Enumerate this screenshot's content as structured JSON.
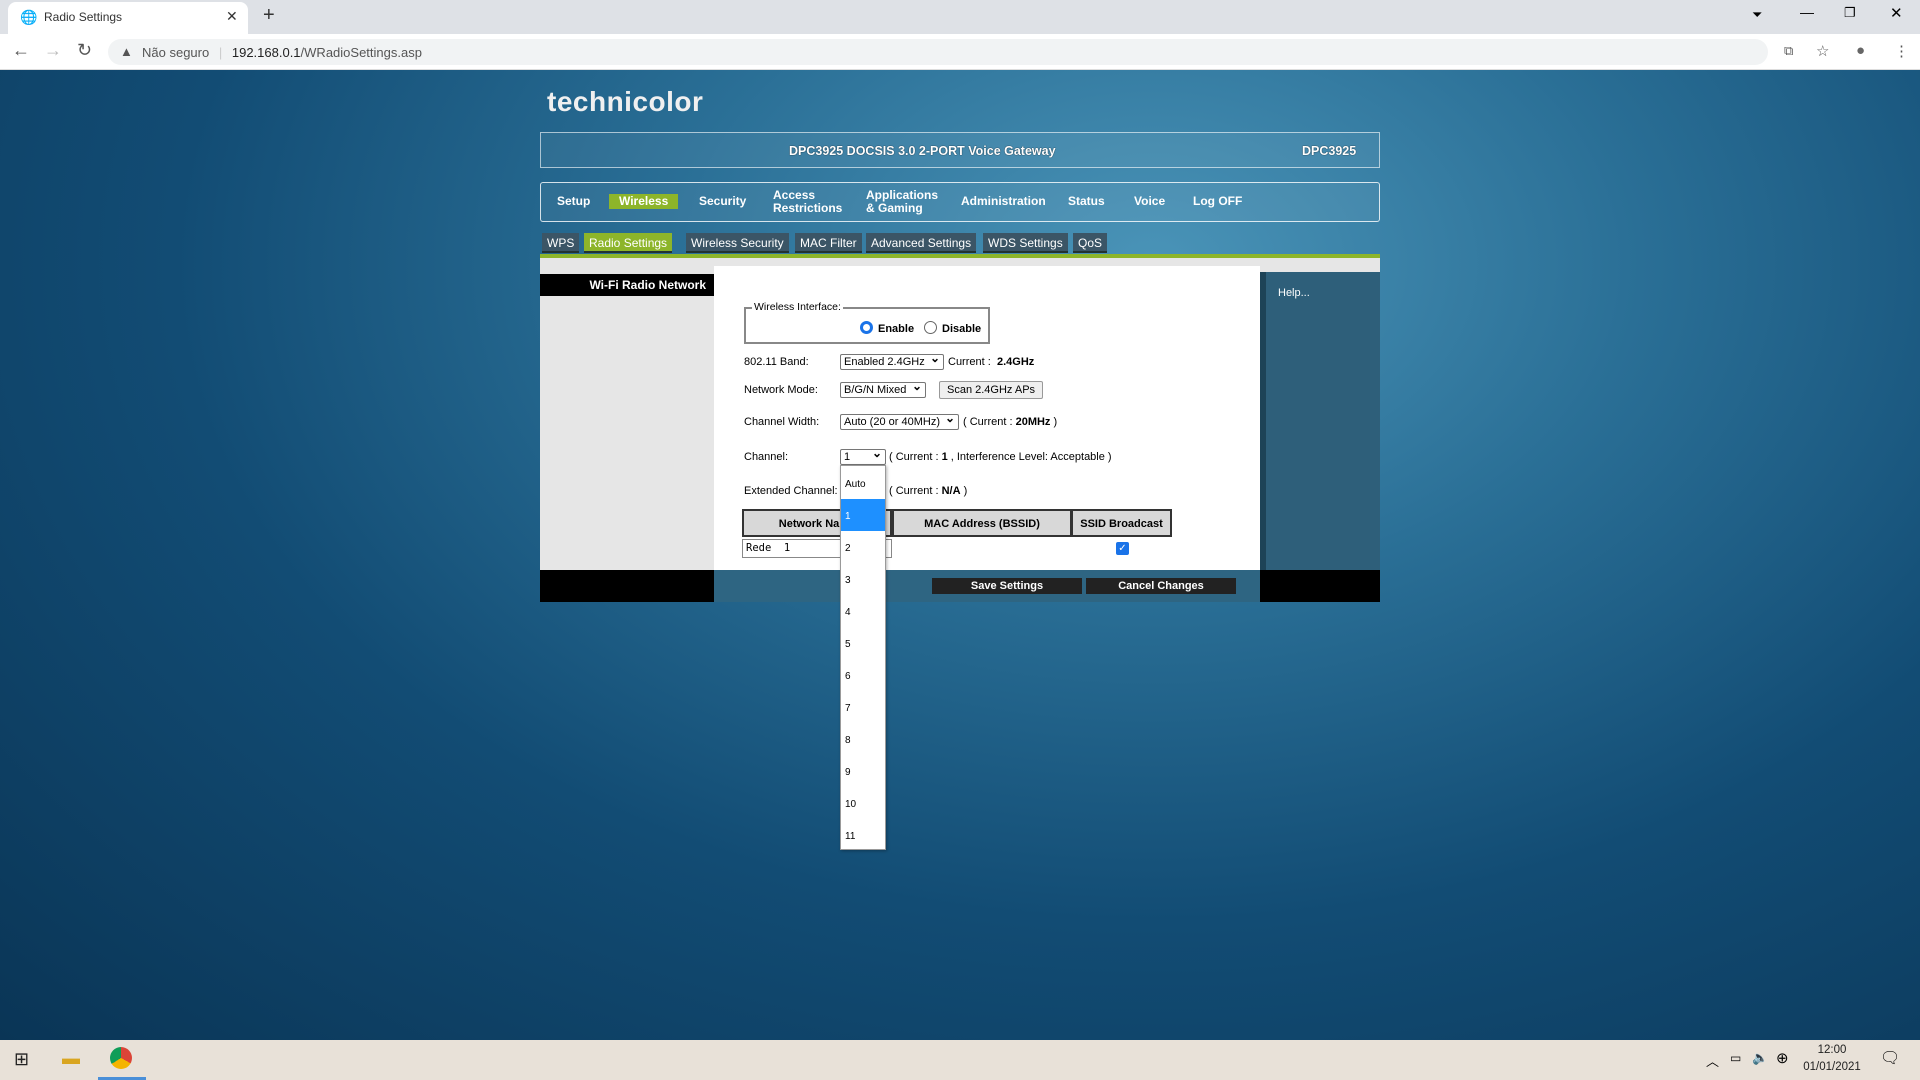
{
  "browser": {
    "tab_title": "Radio Settings",
    "security": "Não seguro",
    "url_host": "192.168.0.1",
    "url_path": "/WRadioSettings.asp"
  },
  "router": {
    "logo": "technicolor",
    "header_title": "DPC3925 DOCSIS 3.0 2-PORT Voice Gateway",
    "model": "DPC3925",
    "nav": [
      {
        "label": "Setup"
      },
      {
        "label": "Wireless",
        "active": true
      },
      {
        "label": "Security"
      },
      {
        "label": "Access",
        "label2": "Restrictions"
      },
      {
        "label": "Applications",
        "label2": "& Gaming"
      },
      {
        "label": "Administration"
      },
      {
        "label": "Status"
      },
      {
        "label": "Voice"
      },
      {
        "label": "Log OFF"
      }
    ],
    "subtabs": [
      {
        "label": "WPS"
      },
      {
        "label": "Radio Settings",
        "active": true
      },
      {
        "label": "Wireless Security"
      },
      {
        "label": "MAC Filter"
      },
      {
        "label": "Advanced Settings"
      },
      {
        "label": "WDS Settings"
      },
      {
        "label": "QoS"
      }
    ],
    "section_title": "Wi-Fi Radio Network",
    "help": "Help...",
    "accent": "#8db52a"
  },
  "form": {
    "wireless_interface": {
      "legend": "Wireless Interface:",
      "enable": "Enable",
      "disable": "Disable",
      "selected": "Enable"
    },
    "band": {
      "label": "802.11 Band:",
      "value": "Enabled 2.4GHz",
      "current_label": "Current :",
      "current": "2.4GHz"
    },
    "mode": {
      "label": "Network Mode:",
      "value": "B/G/N Mixed",
      "scan": "Scan 2.4GHz APs"
    },
    "width": {
      "label": "Channel Width:",
      "value": "Auto (20 or 40MHz)",
      "current_open": "( Current :",
      "current": "20MHz",
      "close": ")"
    },
    "channel": {
      "label": "Channel:",
      "value": "1",
      "current_open": "( Current :",
      "current": "1",
      "interference": ", Interference Level: Acceptable )",
      "options": [
        "Auto",
        "1",
        "2",
        "3",
        "4",
        "5",
        "6",
        "7",
        "8",
        "9",
        "10",
        "11"
      ],
      "highlighted": "1"
    },
    "extended": {
      "label": "Extended Channel:",
      "current_open": "( Current :",
      "current": "N/A",
      "close": ")"
    },
    "table": {
      "headers": [
        "Network Name",
        "MAC Address (BSSID)",
        "SSID Broadcast"
      ],
      "row": {
        "name": "Rede  1",
        "ssid_broadcast": true
      }
    },
    "save": "Save Settings",
    "cancel": "Cancel Changes"
  },
  "taskbar": {
    "time": "12:00",
    "date": "01/01/2021"
  }
}
